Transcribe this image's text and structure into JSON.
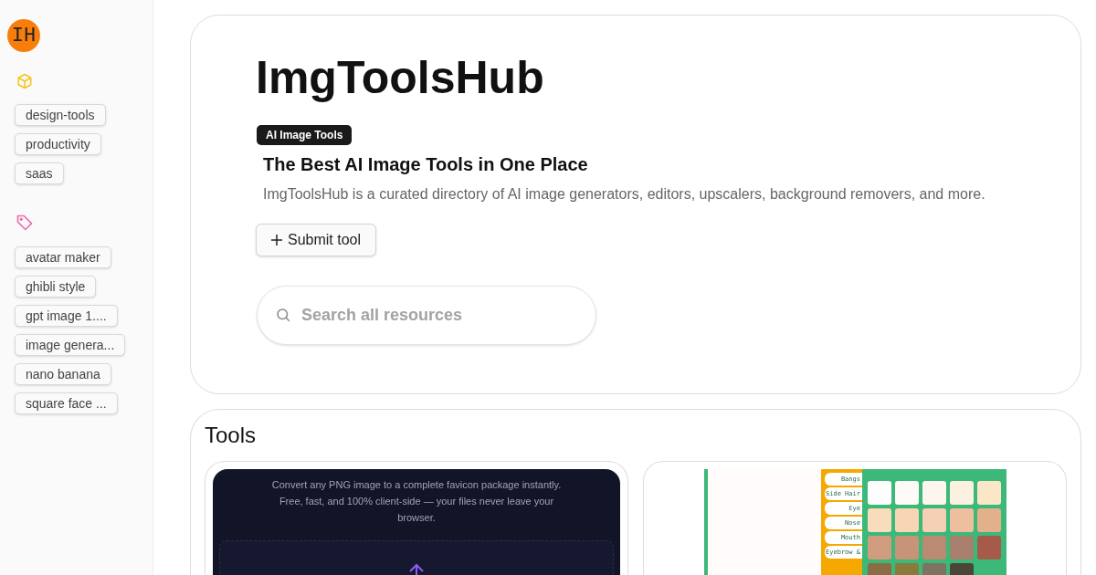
{
  "sidebar": {
    "logo": "IH",
    "categories": [
      {
        "label": "design-tools"
      },
      {
        "label": "productivity"
      },
      {
        "label": "saas"
      }
    ],
    "tags": [
      {
        "label": "avatar maker"
      },
      {
        "label": "ghibli style"
      },
      {
        "label": "gpt image 1...."
      },
      {
        "label": "image genera..."
      },
      {
        "label": "nano banana"
      },
      {
        "label": "square face ..."
      }
    ]
  },
  "hero": {
    "title": "ImgToolsHub",
    "badge": "AI Image Tools",
    "heading": "The Best AI Image Tools in One Place",
    "description": "ImgToolsHub is a curated directory of AI image generators, editors, upscalers, background removers, and more.",
    "submit_button": "Submit tool",
    "search": {
      "placeholder": "Search all resources"
    }
  },
  "tools": {
    "title": "Tools",
    "cards": [
      {
        "kind": "favicon",
        "text": "Convert any PNG image to a complete favicon package instantly. Free, fast, and 100% client-side — your files never leave your browser."
      },
      {
        "kind": "avatar",
        "tabs": [
          "Bangs",
          "Side Hair",
          "Eye",
          "Nose",
          "Mouth",
          "Eyebrow &"
        ]
      }
    ]
  }
}
